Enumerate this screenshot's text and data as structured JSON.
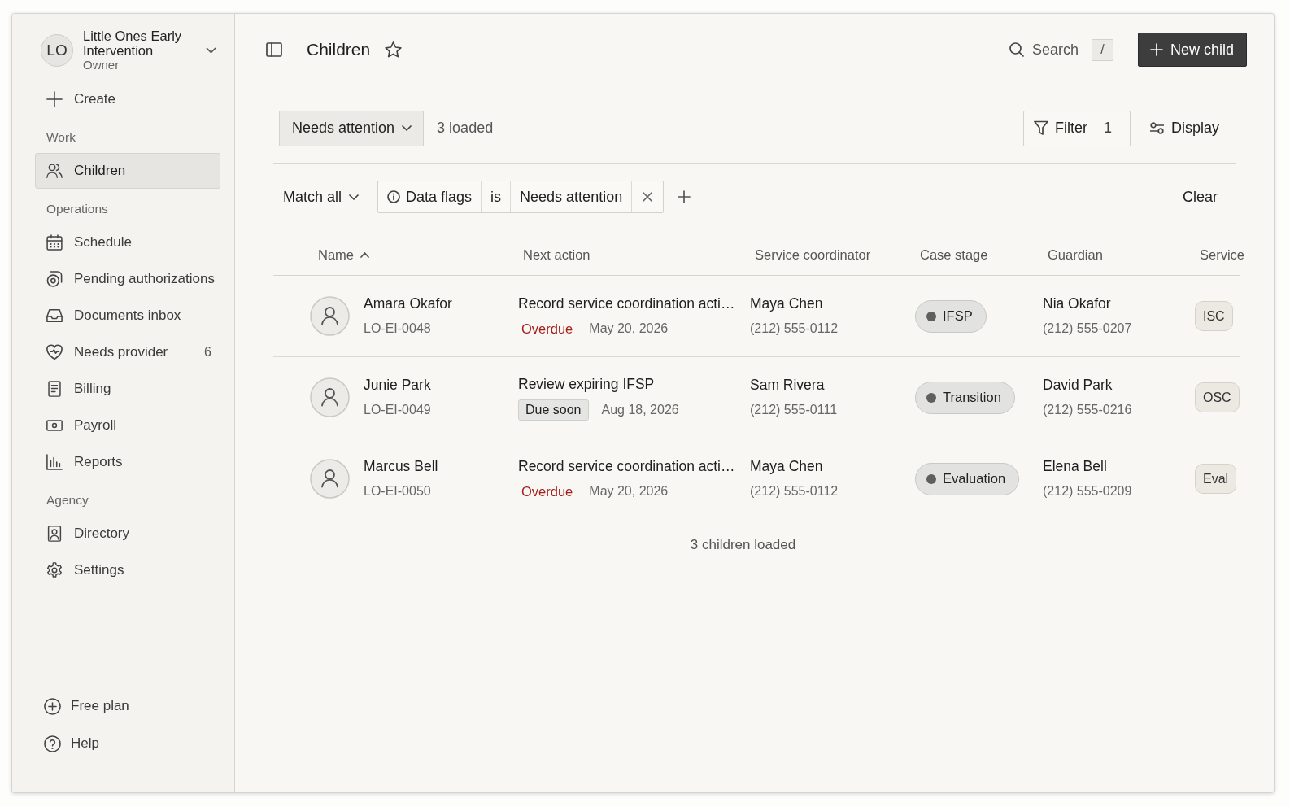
{
  "sidebar": {
    "workspace": {
      "initials": "LO",
      "name": "Little Ones Early Intervention",
      "role": "Owner"
    },
    "create": "Create",
    "sections": [
      {
        "label": "Work",
        "items": [
          {
            "label": "Children",
            "selected": true
          }
        ]
      },
      {
        "label": "Operations",
        "items": [
          {
            "label": "Schedule",
            "selected": false
          },
          {
            "label": "Pending authorizations",
            "selected": false
          },
          {
            "label": "Documents inbox",
            "selected": false
          },
          {
            "label": "Needs provider",
            "selected": false,
            "count": "6"
          },
          {
            "label": "Billing",
            "selected": false
          },
          {
            "label": "Payroll",
            "selected": false
          },
          {
            "label": "Reports",
            "selected": false
          }
        ]
      },
      {
        "label": "Agency",
        "items": [
          {
            "label": "Directory",
            "selected": false
          },
          {
            "label": "Settings",
            "selected": false
          }
        ]
      }
    ],
    "footer_items": [
      {
        "label": "Free plan"
      },
      {
        "label": "Help"
      }
    ]
  },
  "header": {
    "title": "Children",
    "search": "Search",
    "search_shortcut": "/",
    "new_button": "New child"
  },
  "toolbar": {
    "view": "Needs attention",
    "loaded": "3 loaded",
    "filter": "Filter",
    "filter_count": "1",
    "display": "Display"
  },
  "filter_bar": {
    "match": "Match all",
    "conditions": [
      {
        "field": "Data flags",
        "operator": "is",
        "value": "Needs attention"
      }
    ],
    "clear": "Clear"
  },
  "table": {
    "columns": [
      {
        "label": "Name",
        "sorted": true
      },
      {
        "label": "Next action"
      },
      {
        "label": "Service coordinator"
      },
      {
        "label": "Case stage"
      },
      {
        "label": "Guardian"
      },
      {
        "label": "Service"
      }
    ],
    "rows": [
      {
        "name": "Amara Okafor",
        "child_id": "LO-EI-0048",
        "next_action": "Record service coordination acti…",
        "due": {
          "kind": "overdue",
          "label": "Overdue"
        },
        "due_date": "May 20, 2026",
        "coordinator": "Maya Chen",
        "coordinator_phone": "(212) 555-0112",
        "case_stage": "IFSP",
        "guardian": "Nia Okafor",
        "guardian_phone": "(212) 555-0207",
        "service": "ISC"
      },
      {
        "name": "Junie Park",
        "child_id": "LO-EI-0049",
        "next_action": "Review expiring IFSP",
        "due": {
          "kind": "due_soon",
          "label": "Due soon"
        },
        "due_date": "Aug 18, 2026",
        "coordinator": "Sam Rivera",
        "coordinator_phone": "(212) 555-0111",
        "case_stage": "Transition",
        "guardian": "David Park",
        "guardian_phone": "(212) 555-0216",
        "service": "OSC"
      },
      {
        "name": "Marcus Bell",
        "child_id": "LO-EI-0050",
        "next_action": "Record service coordination acti…",
        "due": {
          "kind": "overdue",
          "label": "Overdue"
        },
        "due_date": "May 20, 2026",
        "coordinator": "Maya Chen",
        "coordinator_phone": "(212) 555-0112",
        "case_stage": "Evaluation",
        "guardian": "Elena Bell",
        "guardian_phone": "(212) 555-0209",
        "service": "Eval"
      }
    ]
  },
  "footer": "3 children loaded"
}
